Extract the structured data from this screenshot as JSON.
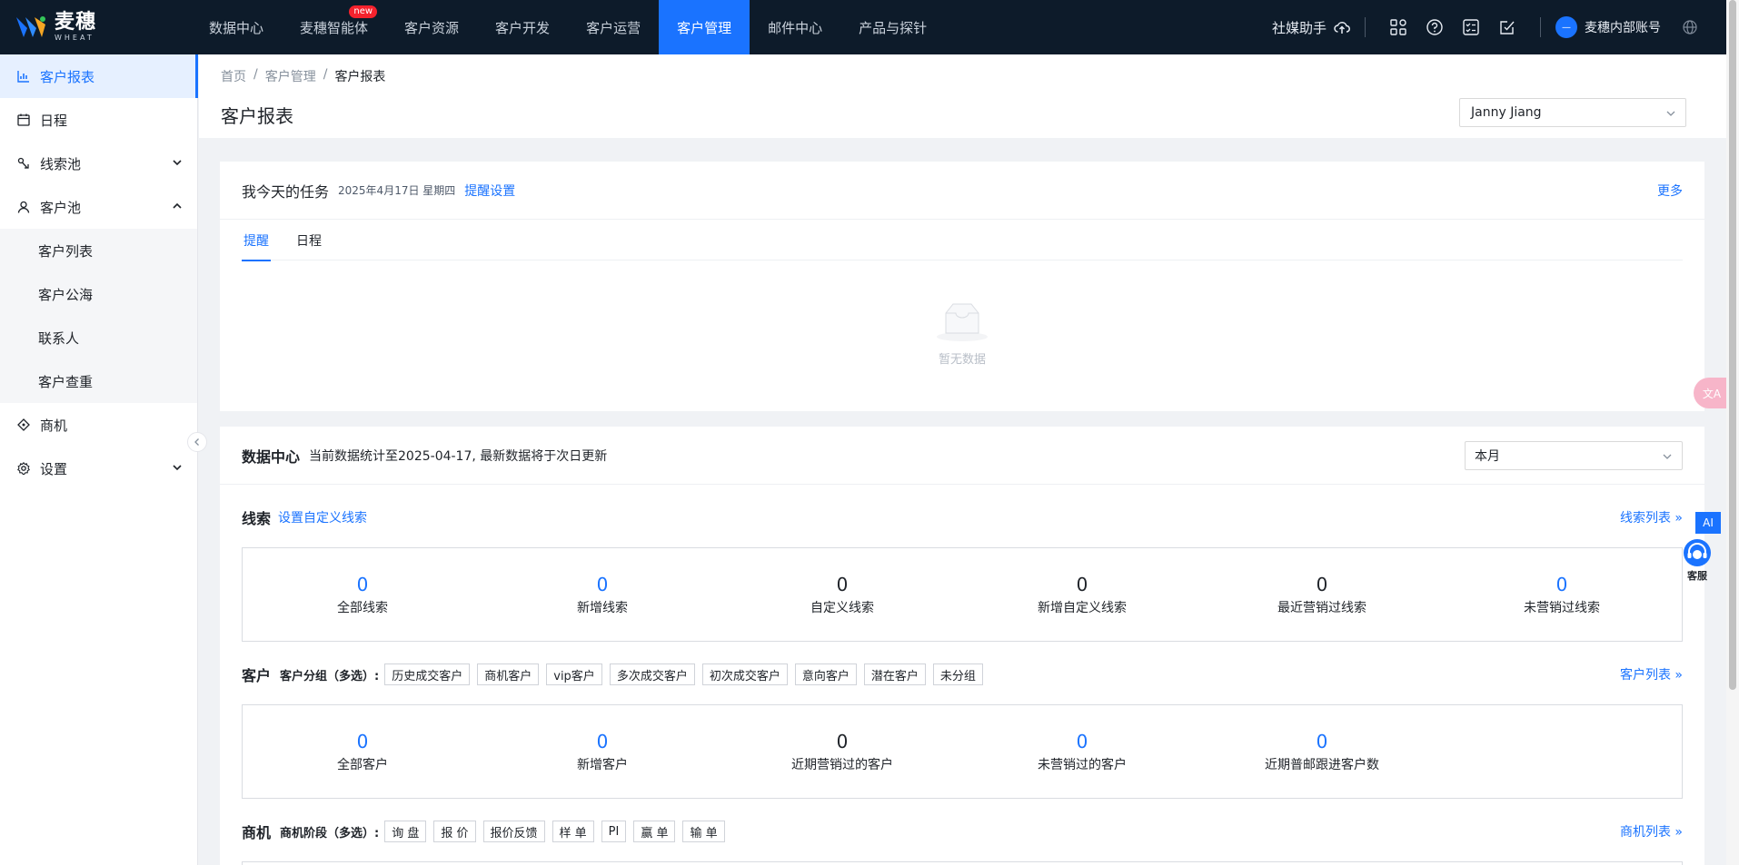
{
  "brand": {
    "name_cn": "麦穗",
    "name_en": "WHEAT"
  },
  "nav": {
    "items": [
      {
        "label": "数据中心",
        "active": false
      },
      {
        "label": "麦穗智能体",
        "active": false,
        "badge": "new"
      },
      {
        "label": "客户资源",
        "active": false
      },
      {
        "label": "客户开发",
        "active": false
      },
      {
        "label": "客户运营",
        "active": false
      },
      {
        "label": "客户管理",
        "active": true
      },
      {
        "label": "邮件中心",
        "active": false
      },
      {
        "label": "产品与探针",
        "active": false
      }
    ],
    "social_helper": "社媒助手",
    "account_name": "麦穗内部账号"
  },
  "sidebar": {
    "items": [
      {
        "label": "客户报表",
        "icon": "bar-chart-icon",
        "active": true
      },
      {
        "label": "日程",
        "icon": "calendar-icon"
      },
      {
        "label": "线索池",
        "icon": "clue-icon",
        "chevron": "down"
      },
      {
        "label": "客户池",
        "icon": "user-icon",
        "chevron": "up"
      },
      {
        "label": "商机",
        "icon": "opportunity-icon"
      },
      {
        "label": "设置",
        "icon": "gear-icon",
        "chevron": "down"
      }
    ],
    "sub_items": [
      "客户列表",
      "客户公海",
      "联系人",
      "客户查重"
    ]
  },
  "header": {
    "breadcrumb": [
      "首页",
      "客户管理",
      "客户报表"
    ],
    "title": "客户报表",
    "user_select": "Janny Jiang"
  },
  "tasks": {
    "title": "我今天的任务",
    "date": "2025年4月17日 星期四",
    "setting": "提醒设置",
    "more": "更多",
    "tabs": [
      "提醒",
      "日程"
    ],
    "empty": "暂无数据"
  },
  "data_center": {
    "title": "数据中心",
    "note": "当前数据统计至2025-04-17, 最新数据将于次日更新",
    "period": "本月",
    "clues": {
      "title": "线索",
      "link": "设置自定义线索",
      "list_link": "线索列表",
      "stats": [
        {
          "value": "0",
          "label": "全部线索",
          "blue": true
        },
        {
          "value": "0",
          "label": "新增线索",
          "blue": true
        },
        {
          "value": "0",
          "label": "自定义线索",
          "blue": false
        },
        {
          "value": "0",
          "label": "新增自定义线索",
          "blue": false
        },
        {
          "value": "0",
          "label": "最近营销过线索",
          "blue": false
        },
        {
          "value": "0",
          "label": "未营销过线索",
          "blue": true
        }
      ]
    },
    "customers": {
      "title": "客户",
      "group_label": "客户分组（多选）:",
      "chips": [
        "历史成交客户",
        "商机客户",
        "vip客户",
        "多次成交客户",
        "初次成交客户",
        "意向客户",
        "潜在客户",
        "未分组"
      ],
      "list_link": "客户列表",
      "stats": [
        {
          "value": "0",
          "label": "全部客户",
          "blue": true
        },
        {
          "value": "0",
          "label": "新增客户",
          "blue": true
        },
        {
          "value": "0",
          "label": "近期营销过的客户",
          "blue": false
        },
        {
          "value": "0",
          "label": "未营销过的客户",
          "blue": true
        },
        {
          "value": "0",
          "label": "近期普邮跟进客户数",
          "blue": true
        }
      ]
    },
    "opportunities": {
      "title": "商机",
      "stage_label": "商机阶段（多选）:",
      "chips": [
        "询 盘",
        "报 价",
        "报价反馈",
        "样 单",
        "PI",
        "赢 单",
        "输 单"
      ],
      "list_link": "商机列表"
    }
  },
  "floaters": {
    "ai": "AI",
    "service": "客服"
  },
  "colors": {
    "primary": "#1a73ff",
    "nav_bg": "#0d1b2a"
  }
}
